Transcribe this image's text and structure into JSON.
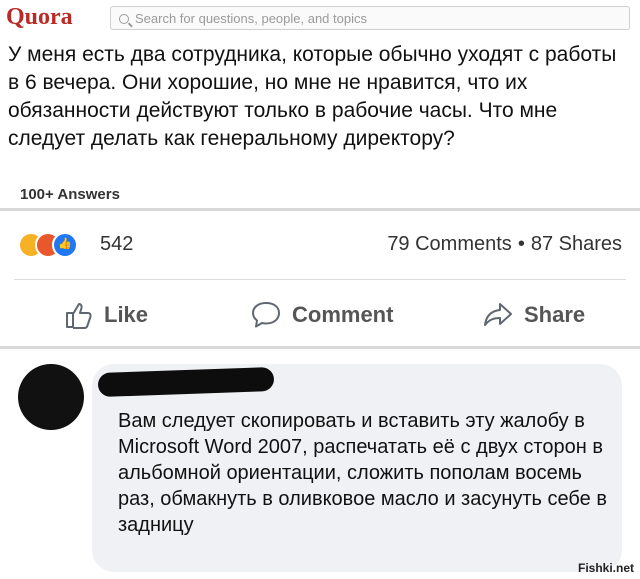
{
  "quora": {
    "logo": "Quora",
    "search_placeholder": "Search for questions, people, and topics"
  },
  "question": {
    "text": "У меня есть два сотрудника, которые обычно уходят с работы в 6 вечера. Они хорошие, но мне не нравится, что их обязанности действуют только в рабочие часы. Что мне следует делать как генеральному директору?",
    "answers_count": "100+ Answers"
  },
  "post": {
    "reactions_count": "542",
    "comments": "79 Comments",
    "separator": "•",
    "shares": "87 Shares",
    "reaction_icons": [
      "haha-icon",
      "angry-icon",
      "like-icon"
    ]
  },
  "actions": {
    "like": "Like",
    "comment": "Comment",
    "share": "Share"
  },
  "comment": {
    "text": "Вам следует скопировать и вставить эту жалобу в Microsoft Word 2007, распечатать её с двух сторон в альбомной ориентации, сложить пополам восемь раз, обмакнуть в оливковое масло и засунуть себе в задницу"
  },
  "watermark": "Fishki.net",
  "colors": {
    "quora_red": "#b92b27",
    "bubble_bg": "#eff1f4",
    "like_blue": "#2078f4"
  }
}
